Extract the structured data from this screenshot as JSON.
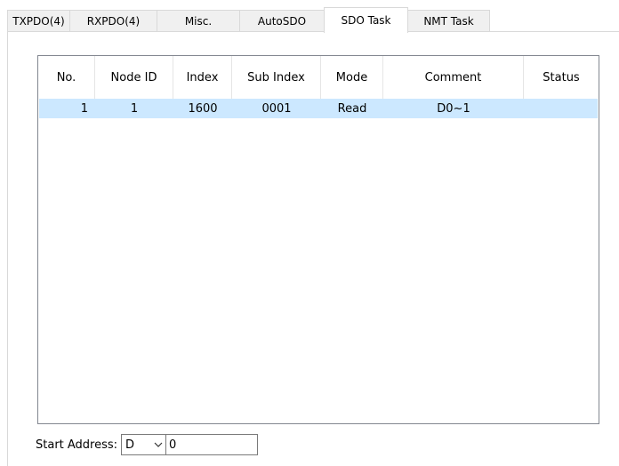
{
  "tabs": [
    {
      "label": "TXPDO(4)",
      "active": false
    },
    {
      "label": "RXPDO(4)",
      "active": false
    },
    {
      "label": "Misc.",
      "active": false
    },
    {
      "label": "AutoSDO",
      "active": false
    },
    {
      "label": "SDO Task",
      "active": true
    },
    {
      "label": "NMT Task",
      "active": false
    }
  ],
  "table": {
    "columns": [
      "No.",
      "Node ID",
      "Index",
      "Sub Index",
      "Mode",
      "Comment",
      "Status"
    ],
    "rows": [
      {
        "no": "1",
        "node_id": "1",
        "index": "1600",
        "sub_index": "0001",
        "mode": "Read",
        "comment": "D0~1",
        "status": "",
        "selected": true
      }
    ]
  },
  "start_address": {
    "label": "Start Address:",
    "device": "D",
    "value": "0"
  },
  "colors": {
    "selected_row": "#cce8ff",
    "border": "#d9d9d9"
  }
}
